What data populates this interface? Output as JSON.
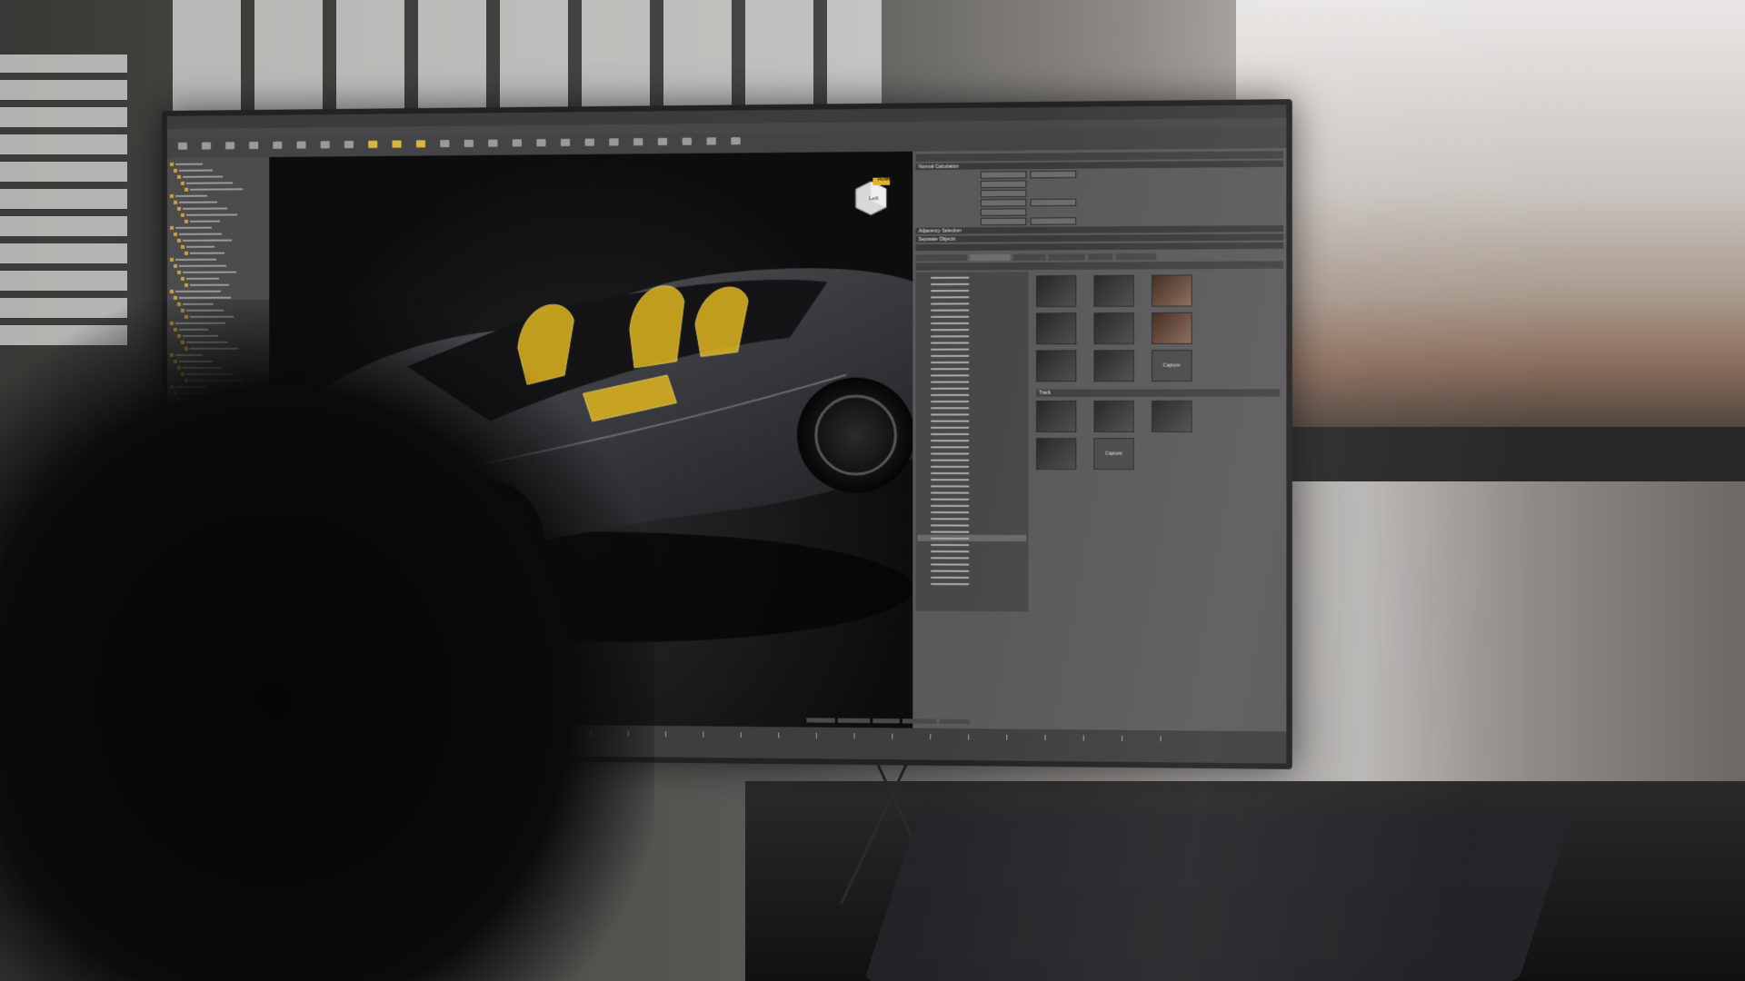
{
  "navcube": {
    "home_label": "HOME",
    "face_label": "Left"
  },
  "panel": {
    "normal_calc_header": "Normal Calculation",
    "adjacency_header": "Adjacency Selection",
    "separate_header": "Separate Objects",
    "capture_label": "Capture"
  },
  "camera": {
    "track_header": "Track",
    "thumbnails": [
      {
        "tone": "dark"
      },
      {
        "tone": "dark"
      },
      {
        "tone": "warm"
      },
      {
        "tone": "dark"
      },
      {
        "tone": "dark"
      },
      {
        "tone": "warm"
      },
      {
        "tone": "dark"
      },
      {
        "tone": "dark"
      }
    ],
    "track_thumbnails": [
      {
        "tone": "dark"
      },
      {
        "tone": "dark"
      },
      {
        "tone": "dark"
      },
      {
        "tone": "dark"
      }
    ]
  },
  "colors": {
    "seat_highlight": "#e0b520",
    "brake_caliper": "#d9a82a",
    "car_body": "#3a3b3f",
    "ui_panel": "#5a5a5c"
  },
  "icons": [
    "navcube-icon",
    "toolbar-tool-icon"
  ]
}
